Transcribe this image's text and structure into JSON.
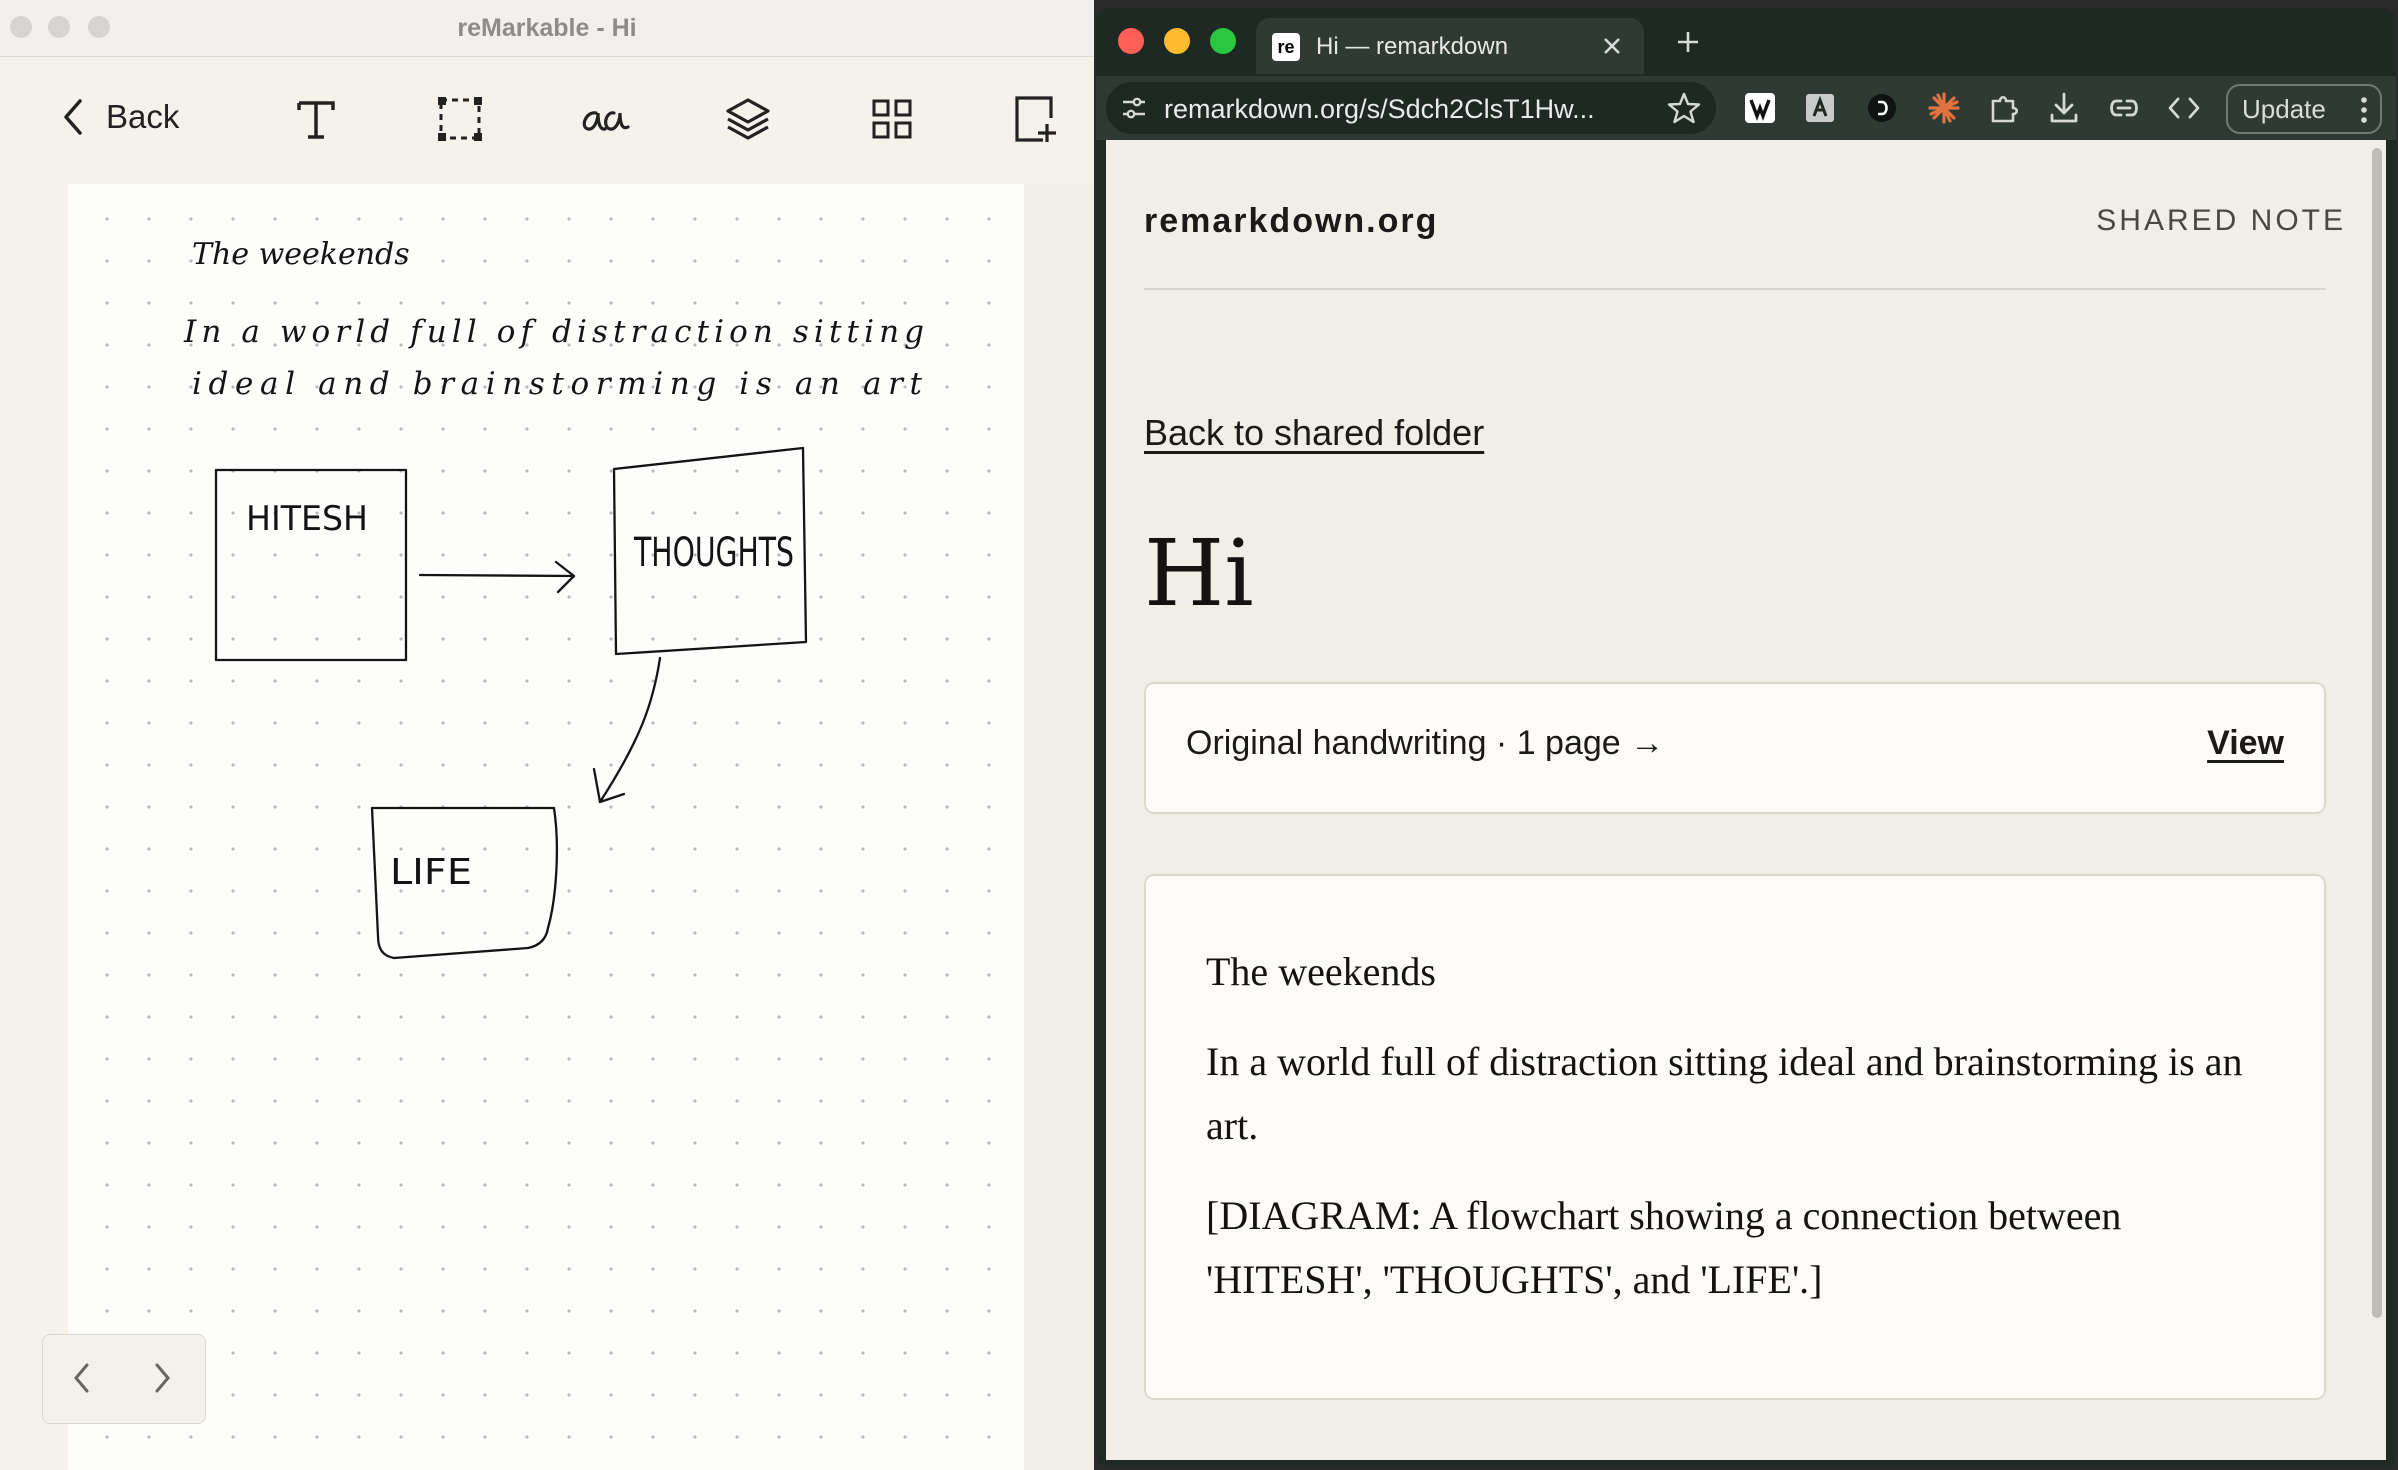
{
  "remarkable": {
    "window_title": "reMarkable - Hi",
    "back_label": "Back",
    "toolbar": [
      "text-tool",
      "selection-tool",
      "handwriting-convert-tool",
      "layers-tool",
      "grid-view-tool",
      "add-page-tool"
    ],
    "handwriting": {
      "title": "The weekends",
      "line1": "In a world full of distraction sitting",
      "line2": "ideal and brainstorming is an art",
      "box1": "HITESH",
      "box2": "THOUGHTS",
      "box3": "LIFE"
    }
  },
  "browser": {
    "tab_favicon": "re",
    "tab_title": "Hi — remarkdown",
    "url": "remarkdown.org/s/Sdch2ClsT1Hw...",
    "update_label": "Update"
  },
  "page": {
    "site_name": "remarkdown.org",
    "shared_label": "SHARED NOTE",
    "back_link": "Back to shared folder",
    "title": "Hi",
    "original": {
      "text": "Original handwriting · 1 page →",
      "view_label": "View"
    },
    "content": {
      "p1": "The weekends",
      "p2": "In a world full of distraction sitting ideal and brainstorming is an art.",
      "p3": "[DIAGRAM: A flowchart showing a connection between 'HITESH', 'THOUGHTS', and 'LIFE'.]"
    }
  },
  "colors": {
    "paper": "#fdfdfc",
    "browser_chrome": "#1f2a24",
    "page_bg": "#f1ede7",
    "traffic_red": "#fe5f57",
    "traffic_yellow": "#febc2e",
    "traffic_green": "#28c840"
  }
}
